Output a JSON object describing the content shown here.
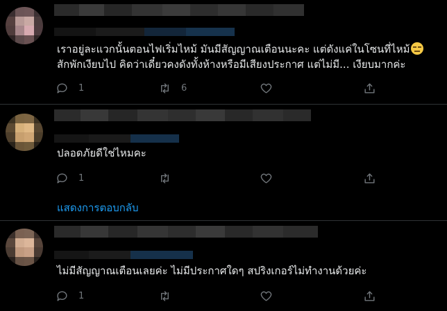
{
  "tweets": [
    {
      "text_lines": [
        "เราอยู่ละแวกนั้นตอนไฟเริ่มไหม้ มันมีสัญญาณเตือนนะคะ แต่ดังแค่ในโซนที่ไหม้",
        "สักพักเงียบไป คิดว่าเดี๋ยวคงดังทั้งห้างหรือมีเสียงประกาศ แต่ไม่มี... เงียบมากค่ะ"
      ],
      "emoji_icon": "expressionless-face-emoji",
      "reply_count": "1",
      "retweet_count": "6",
      "like_count": "",
      "share_label": ""
    },
    {
      "text_lines": [
        "ปลอดภัยดีใช่ไหมคะ"
      ],
      "reply_count": "1",
      "retweet_count": "",
      "like_count": "",
      "show_replies": "แสดงการตอบกลับ"
    },
    {
      "text_lines": [
        "ไม่มีสัญญาณเตือนเลยค่ะ ไม่มีประกาศใดๆ สปริงเกอร์ไม่ทำงานด้วยค่ะ"
      ],
      "reply_count": "1",
      "retweet_count": "",
      "like_count": ""
    }
  ],
  "icons": {
    "reply": "reply-icon",
    "retweet": "retweet-icon",
    "like": "heart-icon",
    "share": "share-icon"
  },
  "colors": {
    "background": "#000000",
    "text": "#e7e9ea",
    "muted": "#71767b",
    "link": "#1d9bf0",
    "divider": "#2f3336"
  }
}
